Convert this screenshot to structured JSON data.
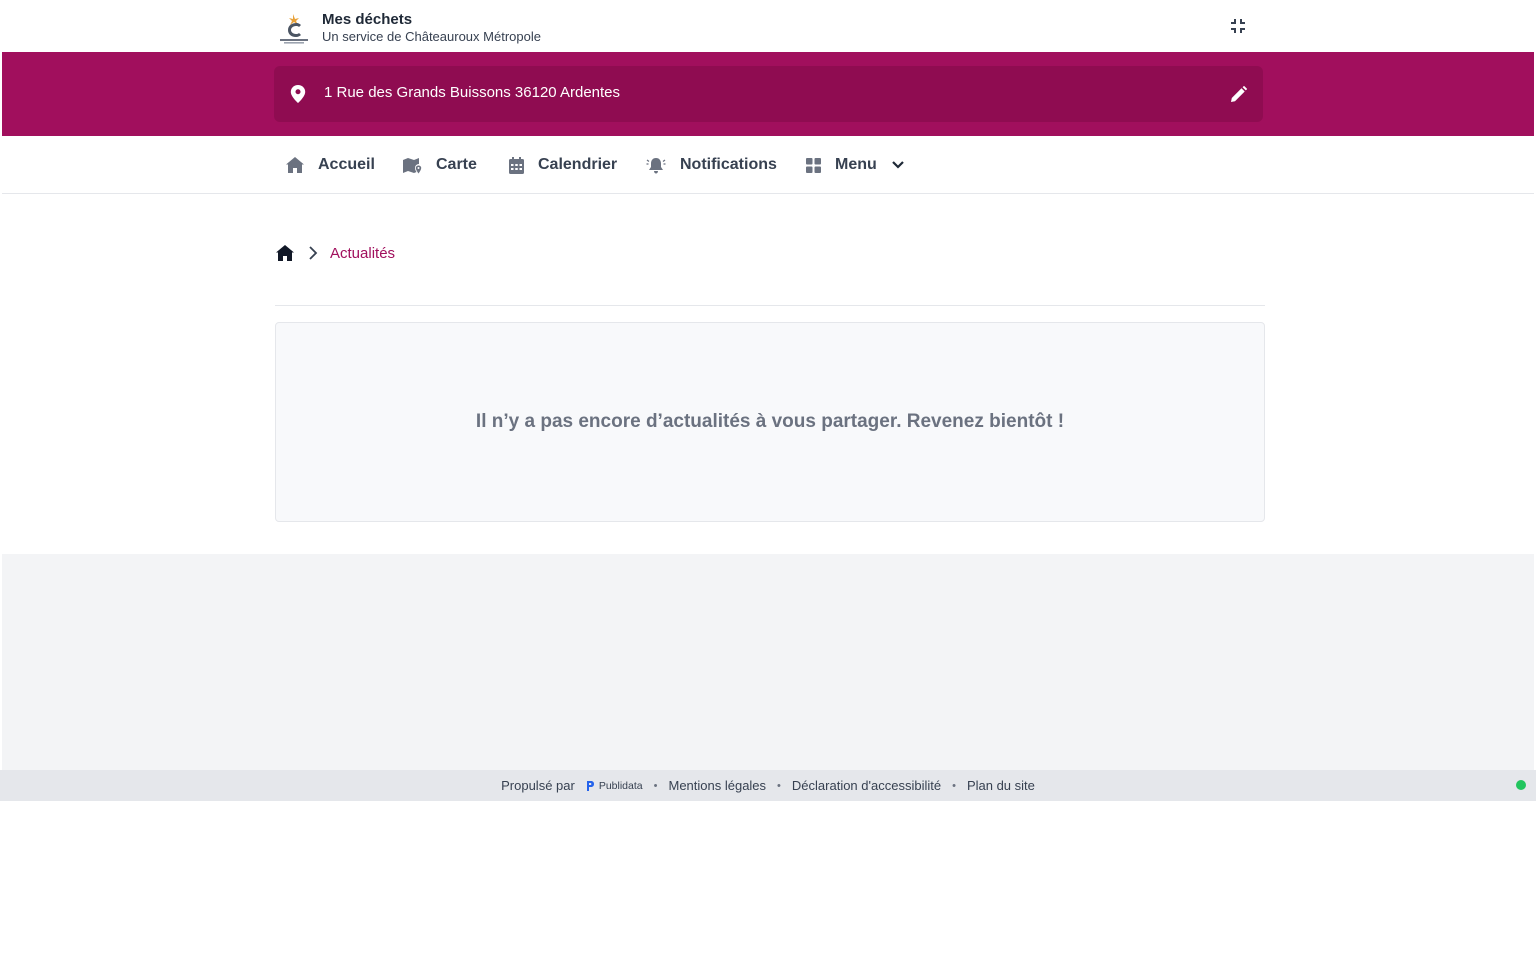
{
  "header": {
    "title": "Mes déchets",
    "subtitle": "Un service de Châteauroux Métropole"
  },
  "address": {
    "text": "1 Rue des Grands Buissons 36120 Ardentes"
  },
  "nav": {
    "items": [
      {
        "label": "Accueil",
        "icon": "home-icon"
      },
      {
        "label": "Carte",
        "icon": "map-icon"
      },
      {
        "label": "Calendrier",
        "icon": "calendar-icon"
      },
      {
        "label": "Notifications",
        "icon": "bell-icon"
      },
      {
        "label": "Menu",
        "icon": "grid-icon"
      }
    ]
  },
  "breadcrumb": {
    "current": "Actualités"
  },
  "content": {
    "empty_message": "Il n’y a pas encore d’actualités à vous partager. Revenez bientôt !"
  },
  "footer": {
    "powered_by": "Propulsé par",
    "powered_brand": "Publidata",
    "links": [
      "Mentions légales",
      "Déclaration d'accessibilité",
      "Plan du site"
    ]
  },
  "colors": {
    "brand": "#a10f5d",
    "brand_dark": "#8f0c51",
    "status_ok": "#22c55e"
  }
}
